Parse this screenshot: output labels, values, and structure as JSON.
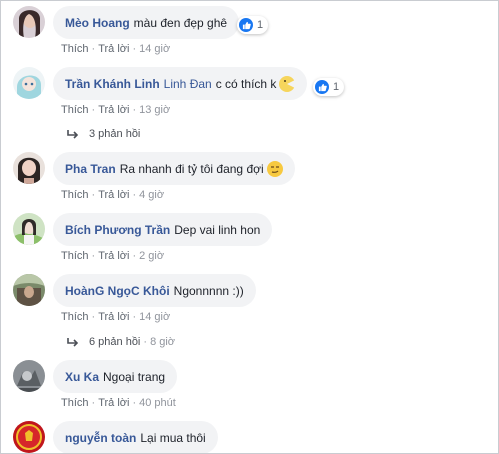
{
  "action_labels": {
    "like": "Thích",
    "reply": "Trả lời",
    "separator": "·"
  },
  "comments": [
    {
      "author": "Mèo Hoang",
      "text": "màu đen đẹp ghê",
      "time": "14 giờ",
      "reactions": "1"
    },
    {
      "author": "Trần Khánh Linh",
      "mention": "Linh Đan",
      "text": "c có thích k",
      "time": "13 giờ",
      "reactions": "1",
      "replies": "3 phản hồi"
    },
    {
      "author": "Pha Tran",
      "text": "Ra nhanh đi tỷ tôi đang đợi",
      "time": "4 giờ"
    },
    {
      "author": "Bích Phương Trần",
      "text": "Dep vai linh hon",
      "time": "2 giờ"
    },
    {
      "author": "HoànG NgọC Khôi",
      "text": "Ngonnnnn :))",
      "time": "14 giờ",
      "replies": "6 phản hồi",
      "replies_time": "8 giờ"
    },
    {
      "author": "Xu Ka",
      "text": "Ngoại trang",
      "time": "40 phút"
    },
    {
      "author": "nguyễn toàn",
      "text": "Lại mua thôi"
    }
  ],
  "colors": {
    "author": "#385898",
    "bubble": "#f2f3f5",
    "like": "#1877f2",
    "meta": "#90949c"
  },
  "icons": {
    "like": "thumbs-up-icon",
    "reply": "reply-arrow-icon"
  }
}
